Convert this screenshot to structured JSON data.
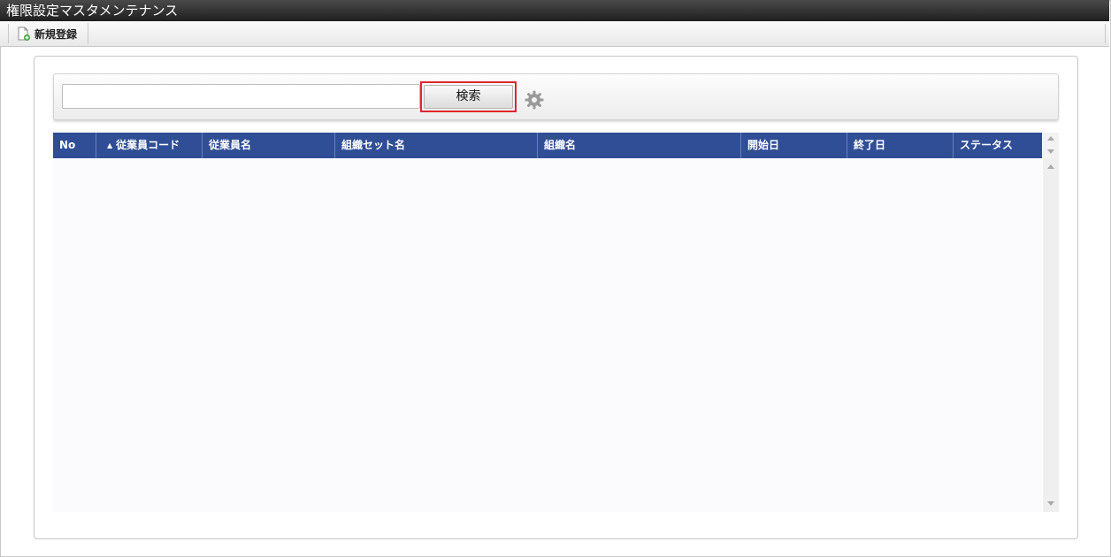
{
  "window": {
    "title": "権限設定マスタメンテナンス"
  },
  "toolbar": {
    "new_label": "新規登録"
  },
  "search": {
    "value": "",
    "placeholder": "",
    "button_label": "検索"
  },
  "grid": {
    "sorted_column": "従業員コード",
    "sort_direction": "ascending",
    "columns": [
      {
        "label": "No"
      },
      {
        "label": "従業員コード"
      },
      {
        "label": "従業員名"
      },
      {
        "label": "組織セット名"
      },
      {
        "label": "組織名"
      },
      {
        "label": "開始日"
      },
      {
        "label": "終了日"
      },
      {
        "label": "ステータス"
      }
    ],
    "rows": []
  },
  "colors": {
    "header_bg": "#2f4e96",
    "highlight": "#e0262c",
    "titlebar_bg": "#1f1f1f"
  },
  "icons": {
    "new": "new-document-icon",
    "settings": "gear-icon",
    "sort": "sort-ascending-icon"
  }
}
